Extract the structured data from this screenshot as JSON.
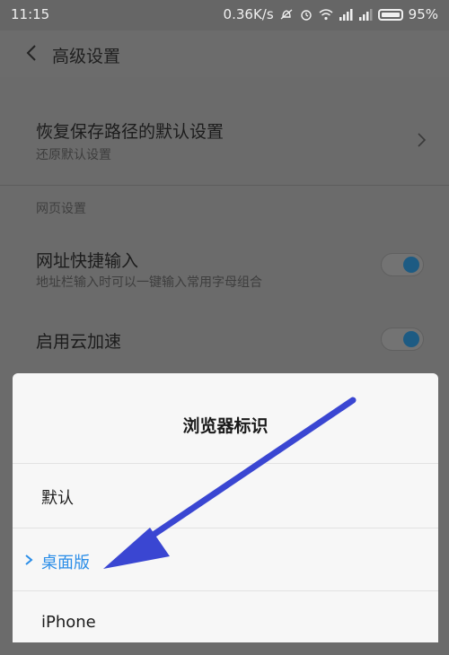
{
  "status_bar": {
    "time": "11:15",
    "net_speed": "0.36K/s",
    "battery_percent": "95%",
    "icons": [
      "mute-icon",
      "alarm-icon",
      "wifi-icon",
      "signal-icon",
      "signal-icon",
      "battery-icon"
    ]
  },
  "app_bar": {
    "title": "高级设置",
    "back_icon": "chevron-left-icon"
  },
  "settings": {
    "restore_path": {
      "title": "恢复保存路径的默认设置",
      "subtitle": "还原默认设置"
    },
    "web_section_header": "网页设置",
    "url_shortcut": {
      "title": "网址快捷输入",
      "subtitle": "地址栏输入时可以一键输入常用字母组合",
      "enabled": true
    },
    "cloud_accel": {
      "title": "启用云加速",
      "enabled": true
    }
  },
  "dialog": {
    "title": "浏览器标识",
    "options": [
      {
        "label": "默认",
        "selected": false
      },
      {
        "label": "桌面版",
        "selected": true
      },
      {
        "label": "iPhone",
        "selected": false
      }
    ]
  },
  "colors": {
    "accent_selected": "#2b8ee8",
    "toggle_knob": "#1d5b83",
    "annotation_arrow": "#3a46d2"
  }
}
